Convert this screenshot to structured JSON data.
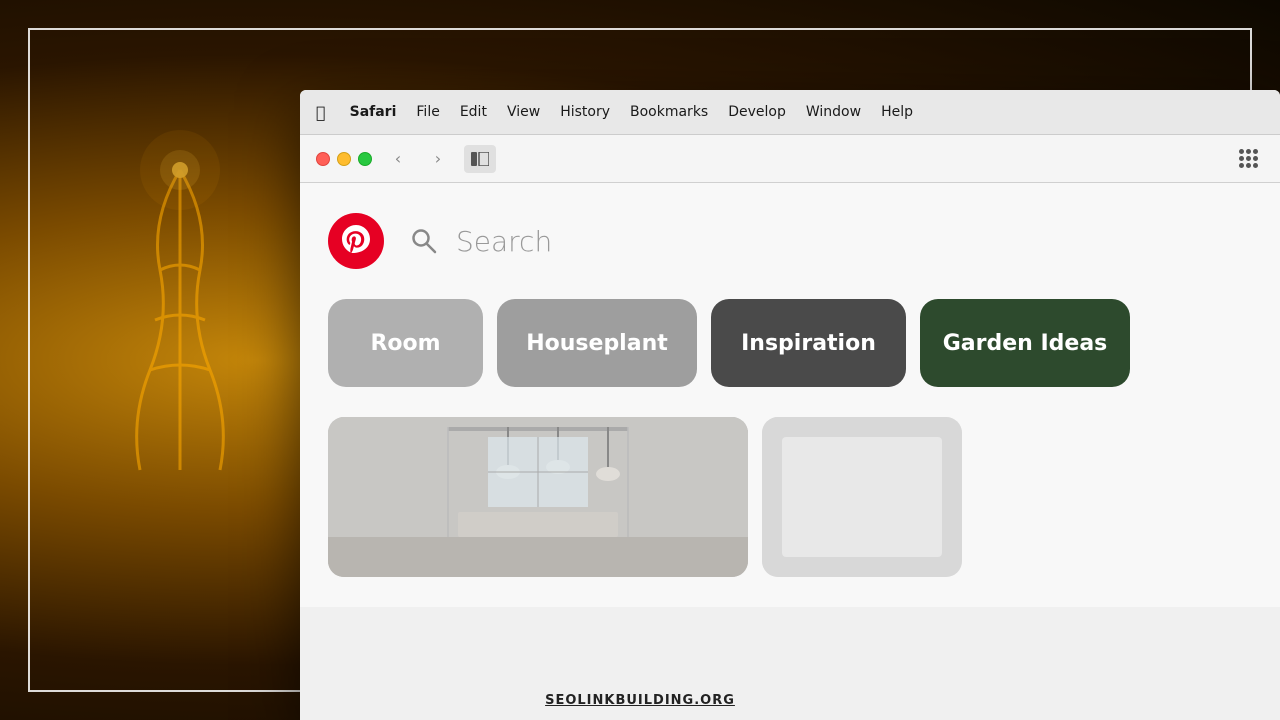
{
  "background": {
    "color": "#1a0f00"
  },
  "menubar": {
    "items": [
      {
        "label": "🍎",
        "id": "apple",
        "bold": false
      },
      {
        "label": "Safari",
        "id": "safari",
        "bold": true
      },
      {
        "label": "File",
        "id": "file",
        "bold": false
      },
      {
        "label": "Edit",
        "id": "edit",
        "bold": false
      },
      {
        "label": "View",
        "id": "view",
        "bold": false
      },
      {
        "label": "History",
        "id": "history",
        "bold": false
      },
      {
        "label": "Bookmarks",
        "id": "bookmarks",
        "bold": false
      },
      {
        "label": "Develop",
        "id": "develop",
        "bold": false
      },
      {
        "label": "Window",
        "id": "window",
        "bold": false
      },
      {
        "label": "Help",
        "id": "help",
        "bold": false
      }
    ]
  },
  "toolbar": {
    "back_label": "‹",
    "forward_label": "›",
    "sidebar_label": "⊟"
  },
  "pinterest": {
    "logo_letter": "p",
    "search_placeholder": "Search",
    "categories": [
      {
        "label": "Room",
        "id": "room",
        "color": "#b0b0b0"
      },
      {
        "label": "Houseplant",
        "id": "houseplant",
        "color": "#9e9e9e"
      },
      {
        "label": "Inspiration",
        "id": "inspiration",
        "color": "#4a4a4a"
      },
      {
        "label": "Garden Ideas",
        "id": "garden",
        "color": "#2d4a2d"
      }
    ]
  },
  "watermark": {
    "text": "SEOLINKBUILDING.ORG"
  }
}
